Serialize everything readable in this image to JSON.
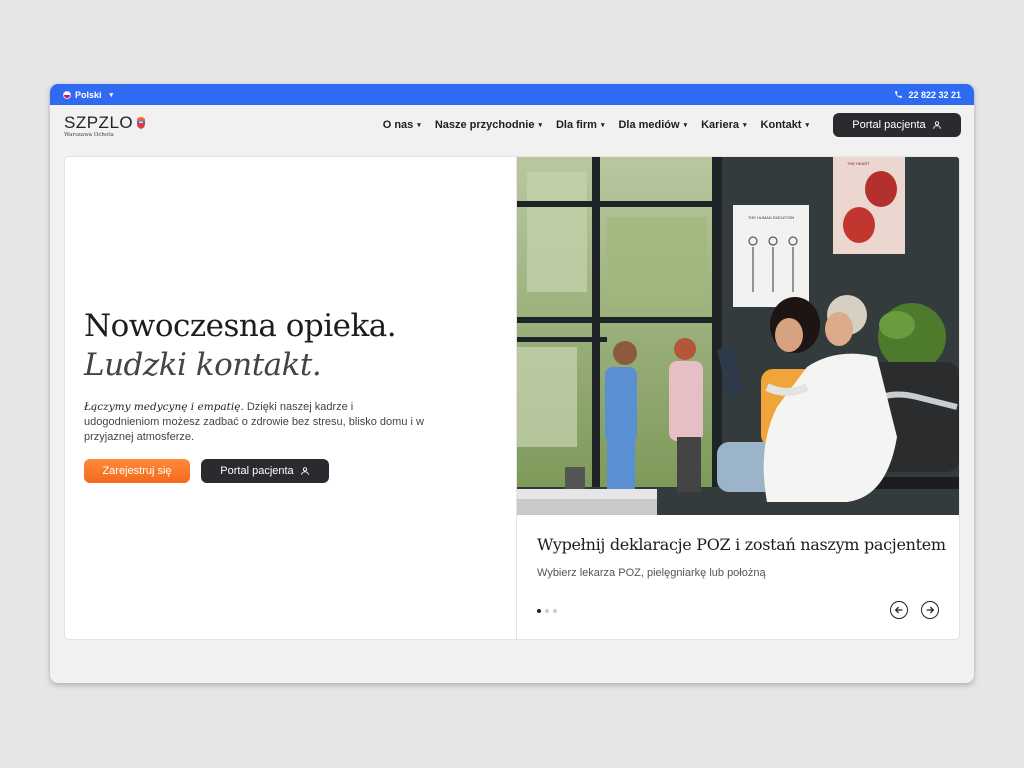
{
  "topbar": {
    "language": "Polski",
    "phone": "22 822 32 21"
  },
  "logo": {
    "name": "SZPZLO",
    "subtitle": "Warszawa Ochota"
  },
  "nav": {
    "items": [
      {
        "label": "O nas"
      },
      {
        "label": "Nasze przychodnie"
      },
      {
        "label": "Dla firm"
      },
      {
        "label": "Dla mediów"
      },
      {
        "label": "Kariera"
      },
      {
        "label": "Kontakt"
      }
    ],
    "portal_label": "Portal pacjenta"
  },
  "hero": {
    "title_line1": "Nowoczesna opieka.",
    "title_line2": "Ludzki kontakt.",
    "lead_emphasis": "Łączymy medycynę i empatię.",
    "lead_text": " Dzięki naszej kadrze i udogodnieniom możesz zadbać o zdrowie bez stresu, blisko domu i w przyjaznej atmosferze.",
    "register_label": "Zarejestruj się",
    "portal_label": "Portal pacjenta"
  },
  "slide": {
    "title": "Wypełnij deklaracje POZ i zostań naszym pacjentem",
    "subtitle": "Wybierz lekarza POZ, pielęgniarkę lub położną",
    "total_slides": 3,
    "active_slide": 1,
    "poster_heart_label": "THE HEART",
    "poster_skeleton_label": "THE HUMAN SKELETON"
  },
  "colors": {
    "topbar": "#2f6bf2",
    "accent_orange": "#f36a1c",
    "dark_button": "#2b2b2f"
  },
  "icons": {
    "phone": "phone-icon",
    "user": "user-icon",
    "prev": "arrow-left-icon",
    "next": "arrow-right-icon"
  }
}
